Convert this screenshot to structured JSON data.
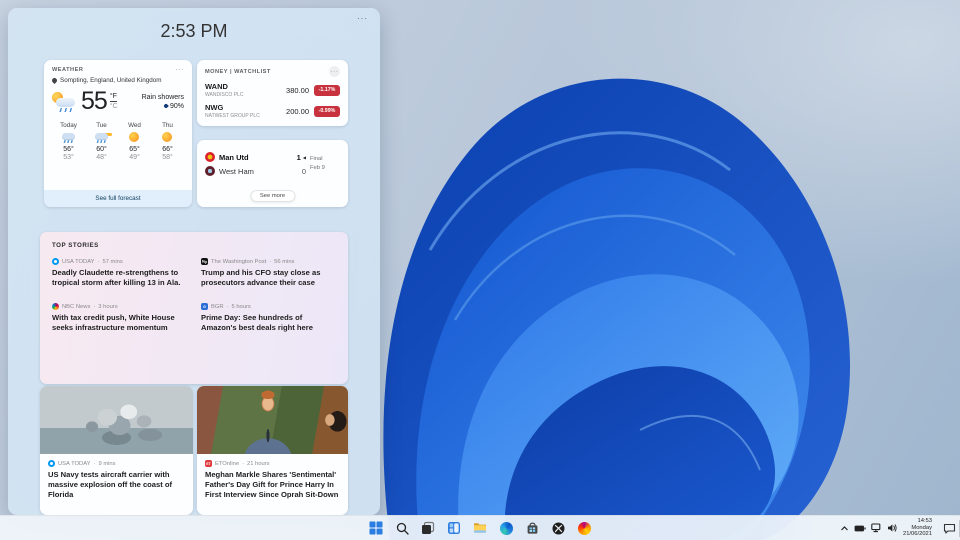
{
  "panel": {
    "time": "2:53 PM",
    "menu": "···",
    "separator": "·",
    "weather": {
      "header": "WEATHER",
      "location": "Sompting, England, United Kingdom",
      "temperature": "55",
      "unit_f": "°F",
      "unit_c": "°C",
      "condition": "Rain showers",
      "precipitation": "90%",
      "main_icon": "sun-cloud-rain",
      "forecast": [
        {
          "day": "Today",
          "icon": "rain",
          "high": "56°",
          "low": "53°"
        },
        {
          "day": "Tue",
          "icon": "rain-sun",
          "high": "60°",
          "low": "48°"
        },
        {
          "day": "Wed",
          "icon": "sunny",
          "high": "65°",
          "low": "49°"
        },
        {
          "day": "Thu",
          "icon": "sunny",
          "high": "66°",
          "low": "58°"
        }
      ],
      "footer": "See full forecast"
    },
    "money": {
      "header": "MONEY | WATCHLIST",
      "menu": "···",
      "stocks": [
        {
          "symbol": "WAND",
          "name": "WANDISCO PLC",
          "price": "380.00",
          "change": "-1.17%"
        },
        {
          "symbol": "NWG",
          "name": "NATWEST GROUP PLC",
          "price": "200.00",
          "change": "-0.99%"
        }
      ],
      "negative_color": "#c8323e"
    },
    "sports": {
      "teams": [
        {
          "name": "Man Utd",
          "score": "1",
          "winner": "◀",
          "crest": "manutd"
        },
        {
          "name": "West Ham",
          "score": "0",
          "winner": "",
          "crest": "westham"
        }
      ],
      "status": "Final",
      "date": "Feb 9",
      "footer": "See more"
    },
    "top_stories": {
      "header": "TOP STORIES",
      "items": [
        {
          "icon": "usa-today",
          "source": "USA TODAY",
          "time": "57 mins",
          "headline": "Deadly Claudette re-strengthens to tropical storm after killing 13 in Ala."
        },
        {
          "icon": "washington-post",
          "source": "The Washington Post",
          "time": "56 mins",
          "headline": "Trump and his CFO stay close as prosecutors advance their case"
        },
        {
          "icon": "nbc-news",
          "source": "NBC News",
          "time": "3 hours",
          "headline": "With tax credit push, White House seeks infrastructure momentum"
        },
        {
          "icon": "bgr",
          "source": "BGR",
          "time": "5 hours",
          "headline": "Prime Day: See hundreds of Amazon's best deals right here"
        }
      ]
    },
    "news_cards": [
      {
        "icon": "usa-today",
        "source": "USA TODAY",
        "time": "9 mins",
        "image": "explosion-at-sea",
        "headline": "US Navy tests aircraft carrier with massive explosion off the coast of Florida"
      },
      {
        "icon": "etonline",
        "source": "ETOnline",
        "time": "21 hours",
        "image": "harry-and-meghan",
        "headline": "Meghan Markle Shares 'Sentimental' Father's Day Gift for Prince Harry In First Interview Since Oprah Sit-Down"
      }
    ]
  },
  "taskbar": {
    "icons": [
      "start",
      "search",
      "task-view",
      "widgets",
      "file-explorer",
      "edge",
      "store",
      "xbox",
      "firefox"
    ],
    "tray_icons": [
      "hidden-icons-chevron",
      "battery",
      "network",
      "volume"
    ],
    "clock": {
      "time": "14:53",
      "day": "Monday",
      "date": "21/06/2021"
    },
    "notification_icon": "chat-bubble"
  },
  "colors": {
    "accent": "#0078d4",
    "bloom_blue_dark": "#0a3fae",
    "bloom_blue_light": "#62aef8",
    "panel_tint": "#d6e8f6",
    "stories_bg_from": "#f7e9f0",
    "stories_bg_to": "#ece7f8"
  }
}
